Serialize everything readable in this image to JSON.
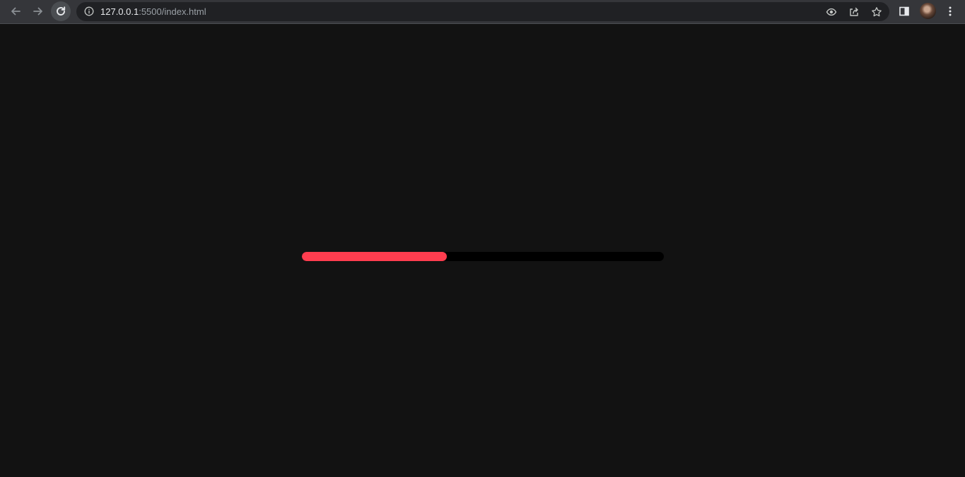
{
  "browser": {
    "url_host": "127.0.0.1",
    "url_rest": ":5500/index.html",
    "icons": {
      "back": "back-arrow-icon",
      "forward": "forward-arrow-icon",
      "reload": "reload-icon",
      "info": "info-icon",
      "eye": "eye-icon",
      "share": "share-icon",
      "star": "star-icon",
      "side_panel": "side-panel-icon",
      "menu": "kebab-menu-icon"
    }
  },
  "progress": {
    "value_fraction": 0.4,
    "fill_color": "#ff3d4f",
    "track_color": "#000000"
  }
}
